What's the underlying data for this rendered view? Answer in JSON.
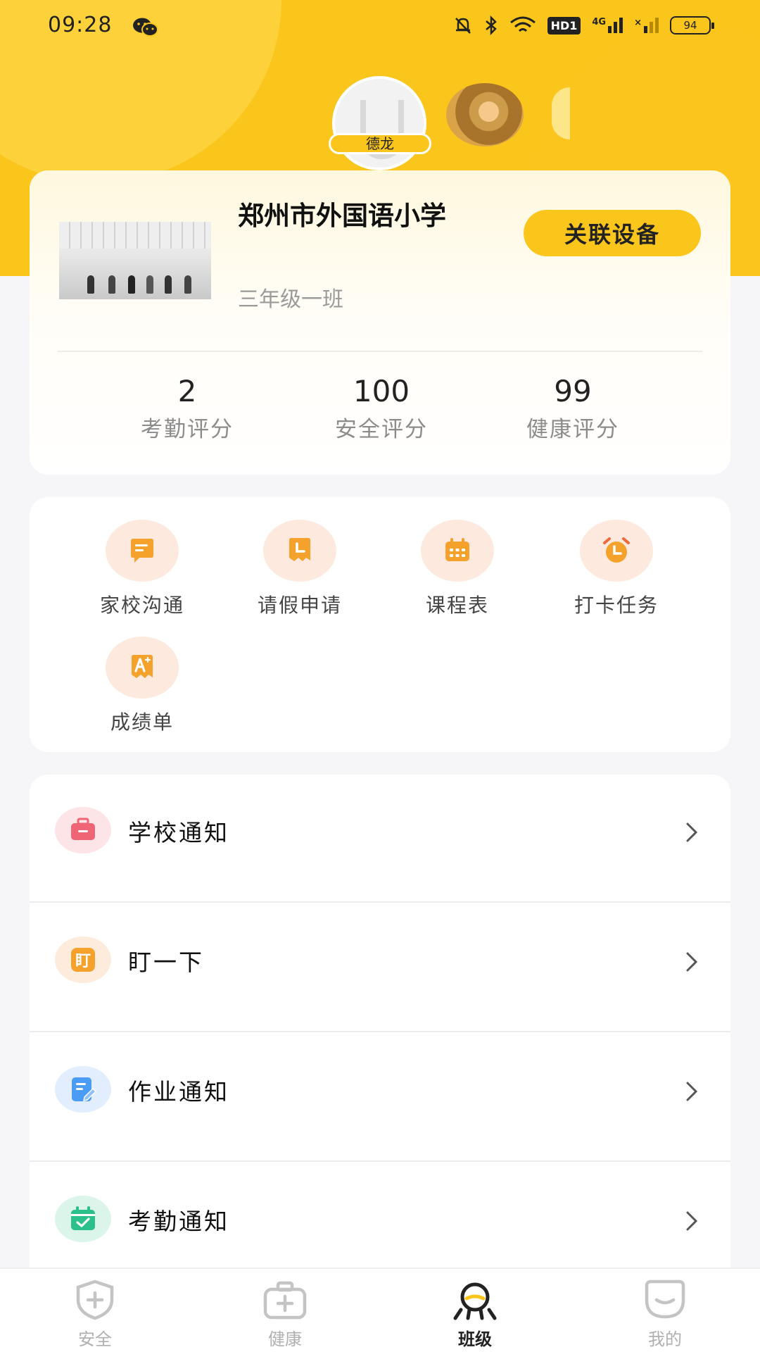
{
  "status_bar": {
    "time": "09:28",
    "hd_label": "HD1",
    "network_label": "4G",
    "battery": "94"
  },
  "profile": {
    "main_child_name": "德龙"
  },
  "school": {
    "name": "郑州市外国语小学",
    "class_name": "三年级一班",
    "link_device_label": "关联设备"
  },
  "stats": [
    {
      "value": "2",
      "label": "考勤评分"
    },
    {
      "value": "100",
      "label": "安全评分"
    },
    {
      "value": "99",
      "label": "健康评分"
    }
  ],
  "features": [
    {
      "label": "家校沟通",
      "icon": "chat-bubble-icon"
    },
    {
      "label": "请假申请",
      "icon": "clock-document-icon"
    },
    {
      "label": "课程表",
      "icon": "calendar-grid-icon"
    },
    {
      "label": "打卡任务",
      "icon": "alarm-clock-icon"
    },
    {
      "label": "成绩单",
      "icon": "grade-a-plus-icon"
    }
  ],
  "notices": [
    {
      "label": "学校通知",
      "icon": "briefcase-icon"
    },
    {
      "label": "盯一下",
      "icon": "stare-badge-icon",
      "icon_text": "盯"
    },
    {
      "label": "作业通知",
      "icon": "edit-document-icon"
    },
    {
      "label": "考勤通知",
      "icon": "calendar-check-icon"
    }
  ],
  "tabbar": [
    {
      "label": "安全",
      "icon": "shield-plus-icon",
      "active": false
    },
    {
      "label": "健康",
      "icon": "medical-kit-icon",
      "active": false
    },
    {
      "label": "班级",
      "icon": "class-people-icon",
      "active": true
    },
    {
      "label": "我的",
      "icon": "profile-face-icon",
      "active": false
    }
  ],
  "colors": {
    "brand_yellow": "#fbc61c",
    "feature_icon_orange": "#f4a22b",
    "text_muted": "#8c8c8c"
  }
}
